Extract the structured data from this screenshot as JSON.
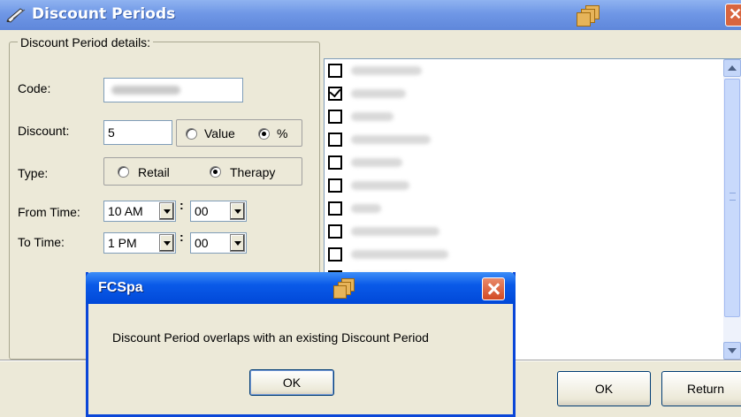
{
  "window": {
    "title": "Discount Periods"
  },
  "details": {
    "legend": "Discount Period details:",
    "code_label": "Code:",
    "code_value": "",
    "discount_label": "Discount:",
    "discount_value": "5",
    "discount_type_options": [
      {
        "label": "Value",
        "selected": false
      },
      {
        "label": "%",
        "selected": true
      }
    ],
    "type_label": "Type:",
    "type_options": [
      {
        "label": "Retail",
        "selected": false
      },
      {
        "label": "Therapy",
        "selected": true
      }
    ],
    "from_time_label": "From Time:",
    "from_hour": "10 AM",
    "from_minute": "00",
    "to_time_label": "To Time:",
    "to_hour": "1 PM",
    "to_minute": "00"
  },
  "list": {
    "items": [
      {
        "checked": false
      },
      {
        "checked": true
      },
      {
        "checked": false
      },
      {
        "checked": false
      },
      {
        "checked": false
      },
      {
        "checked": false
      },
      {
        "checked": false
      },
      {
        "checked": false
      },
      {
        "checked": false
      },
      {
        "checked": false
      }
    ]
  },
  "buttons": {
    "ok": "OK",
    "return": "Return"
  },
  "dialog": {
    "title": "FCSpa",
    "message": "Discount Period overlaps with an existing Discount Period",
    "ok": "OK"
  },
  "icons": {
    "window": "pencil-icon",
    "app": "stacked-windows-icon",
    "close": "close-icon"
  },
  "colors": {
    "titlebar_inactive": "#7a9ee8",
    "titlebar_active": "#0a5ae8",
    "window_bg": "#ece9d8",
    "close_button": "#d24a24"
  }
}
